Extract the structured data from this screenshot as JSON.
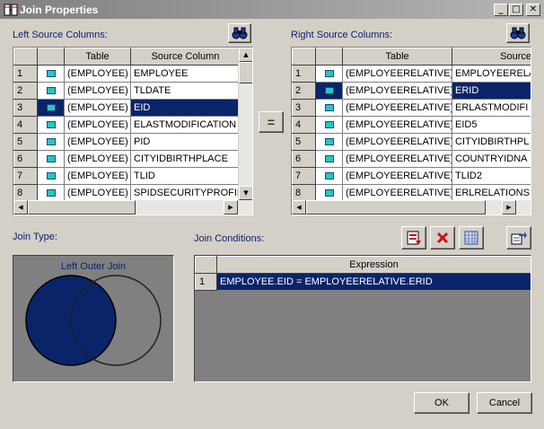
{
  "window": {
    "title": "Join Properties",
    "controls": {
      "minimize": "_",
      "maximize": "□",
      "close": "✕"
    }
  },
  "left": {
    "label": "Left Source Columns:",
    "headers": [
      "Table",
      "Source Column"
    ],
    "rows": [
      {
        "num": "1",
        "table": "(EMPLOYEE)",
        "column": "EMPLOYEE"
      },
      {
        "num": "2",
        "table": "(EMPLOYEE)",
        "column": "TLDATE"
      },
      {
        "num": "3",
        "table": "(EMPLOYEE)",
        "column": "EID"
      },
      {
        "num": "4",
        "table": "(EMPLOYEE)",
        "column": "ELASTMODIFICATION"
      },
      {
        "num": "5",
        "table": "(EMPLOYEE)",
        "column": "PID"
      },
      {
        "num": "6",
        "table": "(EMPLOYEE)",
        "column": "CITYIDBIRTHPLACE"
      },
      {
        "num": "7",
        "table": "(EMPLOYEE)",
        "column": "TLID"
      },
      {
        "num": "8",
        "table": "(EMPLOYEE)",
        "column": "SPIDSECURITYPROFILE"
      }
    ],
    "selected_row": 3
  },
  "right": {
    "label": "Right Source Columns:",
    "headers": [
      "Table",
      "Source"
    ],
    "rows": [
      {
        "num": "1",
        "table": "(EMPLOYEERELATIVE)",
        "column": "EMPLOYEERELA"
      },
      {
        "num": "2",
        "table": "(EMPLOYEERELATIVE)",
        "column": "ERID"
      },
      {
        "num": "3",
        "table": "(EMPLOYEERELATIVE)",
        "column": "ERLASTMODIFI"
      },
      {
        "num": "4",
        "table": "(EMPLOYEERELATIVE)",
        "column": "EID5"
      },
      {
        "num": "5",
        "table": "(EMPLOYEERELATIVE)",
        "column": "CITYIDBIRTHPL"
      },
      {
        "num": "6",
        "table": "(EMPLOYEERELATIVE)",
        "column": "COUNTRYIDNA"
      },
      {
        "num": "7",
        "table": "(EMPLOYEERELATIVE)",
        "column": "TLID2"
      },
      {
        "num": "8",
        "table": "(EMPLOYEERELATIVE)",
        "column": "ERLRELATIONS"
      }
    ],
    "selected_row": 2
  },
  "equals_button": "=",
  "join_type": {
    "label": "Join Type:",
    "value": "Left Outer Join"
  },
  "join_conditions": {
    "label": "Join Conditions:",
    "header": "Expression",
    "rows": [
      {
        "num": "1",
        "expression": "EMPLOYEE.EID = EMPLOYEERELATIVE.ERID"
      }
    ]
  },
  "buttons": {
    "ok": "OK",
    "cancel": "Cancel"
  },
  "icons": {
    "find_left": "binoculars-icon",
    "find_right": "binoculars-icon",
    "new_condition": "new-condition-icon",
    "delete": "delete-x-icon",
    "grid": "grid-icon",
    "export": "export-icon"
  },
  "colors": {
    "selection": "#0a246a",
    "venn_fill": "#0a246a",
    "panel_bg": "#808080"
  }
}
